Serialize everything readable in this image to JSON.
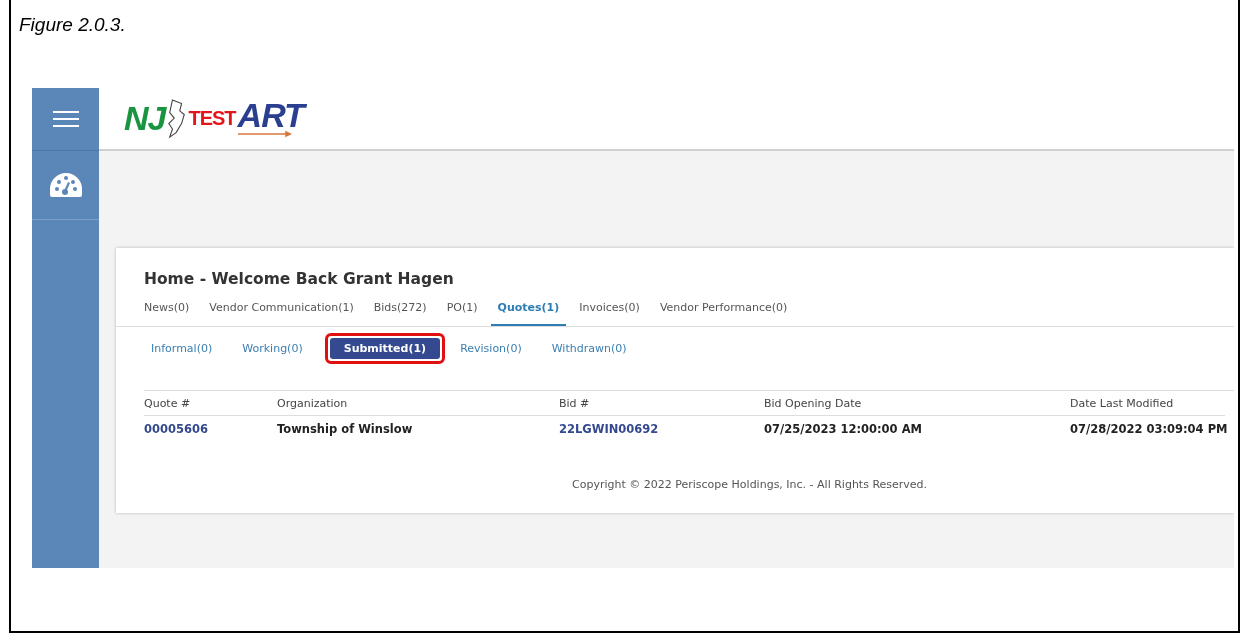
{
  "caption": "Figure 2.0.3.",
  "logo": {
    "part_1": "NJ",
    "part_2": "ART",
    "overlay": "TEST"
  },
  "card": {
    "title": "Home - Welcome Back Grant Hagen",
    "tabs": [
      {
        "label": "News(0)",
        "selected": false
      },
      {
        "label": "Vendor Communication(1)",
        "selected": false
      },
      {
        "label": "Bids(272)",
        "selected": false
      },
      {
        "label": "PO(1)",
        "selected": false
      },
      {
        "label": "Quotes(1)",
        "selected": true
      },
      {
        "label": "Invoices(0)",
        "selected": false
      },
      {
        "label": "Vendor Performance(0)",
        "selected": false
      }
    ],
    "subtabs": [
      {
        "label": "Informal(0)",
        "selected": false,
        "highlighted": false
      },
      {
        "label": "Working(0)",
        "selected": false,
        "highlighted": false
      },
      {
        "label": "Submitted(1)",
        "selected": true,
        "highlighted": true
      },
      {
        "label": "Revision(0)",
        "selected": false,
        "highlighted": false
      },
      {
        "label": "Withdrawn(0)",
        "selected": false,
        "highlighted": false
      }
    ],
    "table": {
      "columns": [
        "Quote #",
        "Organization",
        "Bid #",
        "Bid Opening Date",
        "Date Last Modified"
      ],
      "rows": [
        {
          "cells": [
            {
              "text": "00005606",
              "kind": "link"
            },
            {
              "text": "Township of Winslow",
              "kind": "text"
            },
            {
              "text": "22LGWIN00692",
              "kind": "link"
            },
            {
              "text": "07/25/2023 12:00:00 AM",
              "kind": "text"
            },
            {
              "text": "07/28/2022 03:09:04 PM",
              "kind": "text"
            }
          ]
        }
      ]
    },
    "footer": "Copyright © 2022 Periscope Holdings, Inc. - All Rights Reserved."
  }
}
